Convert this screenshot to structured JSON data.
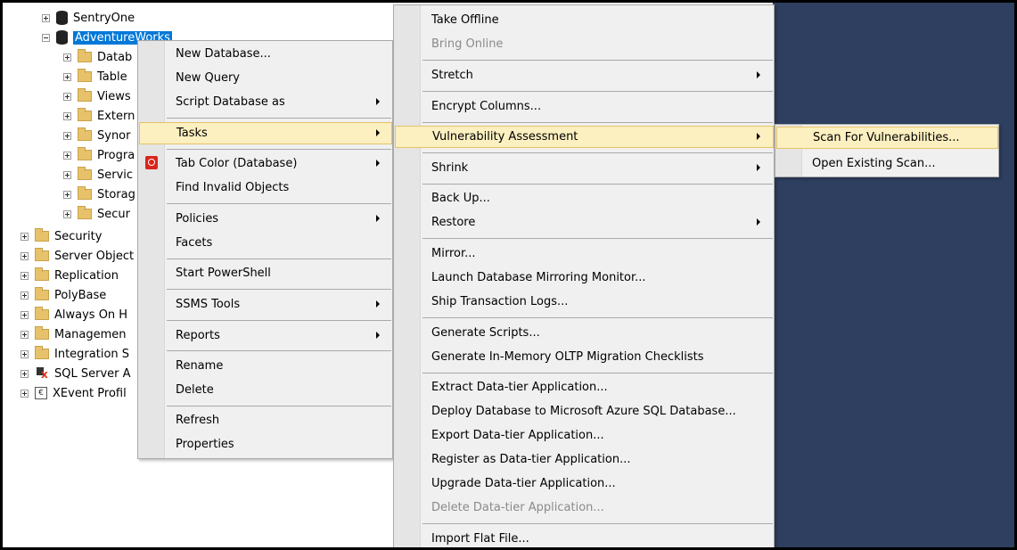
{
  "tree": {
    "servers": [
      {
        "label": "SentryOne"
      },
      {
        "label": "AdventureWorks"
      }
    ],
    "db_children": [
      "Datab",
      "Table",
      "Views",
      "Extern",
      "Synor",
      "Progra",
      "Servic",
      "Storag",
      "Secur"
    ],
    "top_level": [
      "Security",
      "Server Object",
      "Replication",
      "PolyBase",
      "Always On H",
      "Managemen",
      "Integration S",
      "SQL Server A",
      "XEvent Profil"
    ]
  },
  "menu1": {
    "items": {
      "new_database": "New Database...",
      "new_query": "New Query",
      "script_database_as": "Script Database as",
      "tasks": "Tasks",
      "tab_color": "Tab Color (Database)",
      "find_invalid": "Find Invalid Objects",
      "policies": "Policies",
      "facets": "Facets",
      "start_powershell": "Start PowerShell",
      "ssms_tools": "SSMS Tools",
      "reports": "Reports",
      "rename": "Rename",
      "delete": "Delete",
      "refresh": "Refresh",
      "properties": "Properties"
    }
  },
  "menu2": {
    "items": {
      "take_offline": "Take Offline",
      "bring_online": "Bring Online",
      "stretch": "Stretch",
      "encrypt_columns": "Encrypt Columns...",
      "vulnerability_assessment": "Vulnerability Assessment",
      "shrink": "Shrink",
      "back_up": "Back Up...",
      "restore": "Restore",
      "mirror": "Mirror...",
      "launch_mirroring_monitor": "Launch Database Mirroring Monitor...",
      "ship_transaction_logs": "Ship Transaction Logs...",
      "generate_scripts": "Generate Scripts...",
      "generate_oltp_checklists": "Generate In-Memory OLTP Migration Checklists",
      "extract_data_tier": "Extract Data-tier Application...",
      "deploy_azure": "Deploy Database to Microsoft Azure SQL Database...",
      "export_data_tier": "Export Data-tier Application...",
      "register_data_tier": "Register as Data-tier Application...",
      "upgrade_data_tier": "Upgrade Data-tier Application...",
      "delete_data_tier": "Delete Data-tier Application...",
      "import_flat_file": "Import Flat File..."
    }
  },
  "menu3": {
    "items": {
      "scan_for_vulnerabilities": "Scan For Vulnerabilities...",
      "open_existing_scan": "Open Existing Scan..."
    }
  },
  "colors": {
    "selection": "#0078d7",
    "menu_bg": "#f0f0f0",
    "highlight": "#fcefc0",
    "highlight_border": "#e5c365",
    "desktop": "#2e3f5f"
  }
}
